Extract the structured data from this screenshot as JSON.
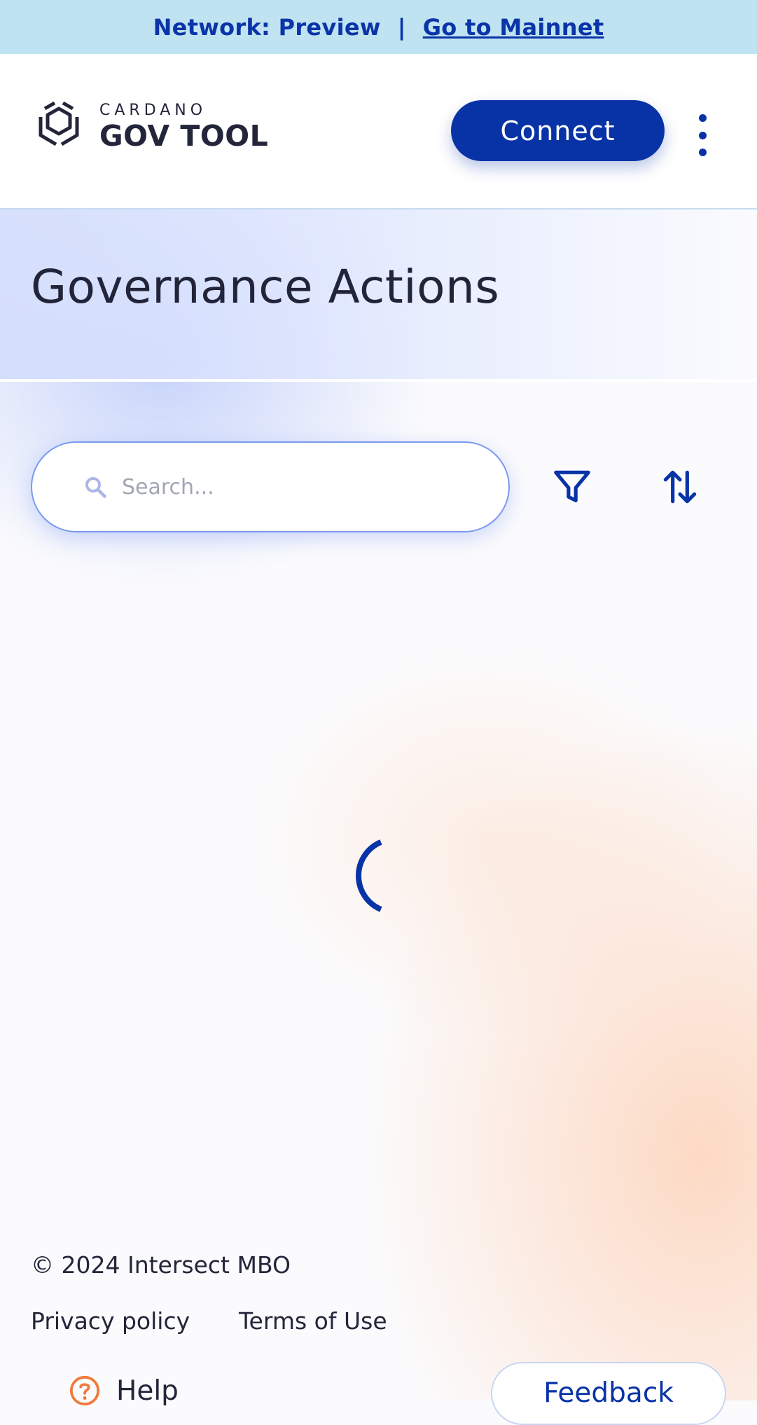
{
  "network_bar": {
    "label": "Network: Preview",
    "separator": "|",
    "link": "Go to Mainnet"
  },
  "header": {
    "logo_small": "CARDANO",
    "logo_big": "GOV TOOL",
    "connect_label": "Connect",
    "menu_icon": "kebab-menu-icon"
  },
  "page": {
    "title": "Governance Actions"
  },
  "search": {
    "placeholder": "Search...",
    "value": "",
    "icon": "search-icon",
    "filter_icon": "filter-icon",
    "sort_icon": "sort-icon"
  },
  "loading": {
    "icon": "loading-spinner-icon"
  },
  "footer": {
    "copyright": "© 2024 Intersect MBO",
    "privacy": "Privacy policy",
    "terms": "Terms of Use",
    "help": "Help",
    "feedback": "Feedback"
  },
  "colors": {
    "primary": "#0833a7",
    "network_bar_bg": "#bfe3f1",
    "help_icon": "#f07a3c"
  }
}
